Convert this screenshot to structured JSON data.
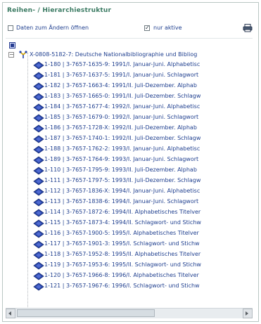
{
  "panel": {
    "title": "Reihen- / Hierarchiestruktur"
  },
  "options": {
    "open_for_edit_label": "Daten zum Ändern öffnen",
    "only_active_label": "nur aktive",
    "only_active_checked": true,
    "open_for_edit_checked": false
  },
  "tree": {
    "root_label": "X-0808-5182-7: Deutsche Nationalbibliographie und Bibliog",
    "children": [
      "1-180 | 3-7657-1635-9: 1991/I. Januar-Juni. Alphabetisc",
      "1-181 | 3-7657-1637-5: 1991/I. Januar-Juni. Schlagwort",
      "1-182 | 3-7657-1663-4: 1991/II. Juli-Dezember. Alphab",
      "1-183 | 3-7657-1665-0: 1991/II. Juli-Dezember. Schlagw",
      "1-184 | 3-7657-1677-4: 1992/I. Januar-Juni. Alphabetisc",
      "1-185 | 3-7657-1679-0: 1992/I. Januar-Juni. Schlagwort",
      "1-186 | 3-7657-1728-X: 1992/II. Juli-Dezember. Alphab",
      "1-187 | 3-7657-1740-1: 1992/II. Juli-Dezember. Schlagw",
      "1-188 | 3-7657-1762-2: 1993/I. Januar-Juni. Alphabetisc",
      "1-189 | 3-7657-1764-9: 1993/I. Januar-Juni. Schlagwort",
      "1-110 | 3-7657-1795-9: 1993/II. Juli-Dezember. Alphab",
      "1-111 | 3-7657-1797-5: 1993/II. Juli-Dezember. Schlagw",
      "1-112 | 3-7657-1836-X: 1994/I. Januar-Juni. Alphabetisc",
      "1-113 | 3-7657-1838-6: 1994/I. Januar-Juni. Schlagwort",
      "1-114 | 3-7657-1872-6: 1994/II. Alphabetisches Titelver",
      "1-115 | 3-7657-1873-4: 1994/II. Schlagwort- und Stichw",
      "1-116 | 3-7657-1900-5: 1995/I. Alphabetisches Titelver",
      "1-117 | 3-7657-1901-3: 1995/I. Schlagwort- und Stichw",
      "1-118 | 3-7657-1952-8: 1995/II. Alphabetisches Titelver",
      "1-119 | 3-7657-1953-6: 1995/II. Schlagwort- und Stichw",
      "1-120 | 3-7657-1966-8: 1996/I. Alphabetisches Titelver",
      "1-121 | 3-7657-1967-6: 1996/I. Schlagwort- und Stichw"
    ]
  },
  "colors": {
    "title": "#3a7a62",
    "text": "#1f3f8f",
    "icon": "#2745a8"
  },
  "icons": {
    "print": "printer-icon",
    "root": "hierarchy-root-icon",
    "child": "book-node-icon",
    "expand": "collapse-minus-icon",
    "scroll_left": "scroll-left-arrow-icon",
    "scroll_right": "scroll-right-arrow-icon"
  }
}
